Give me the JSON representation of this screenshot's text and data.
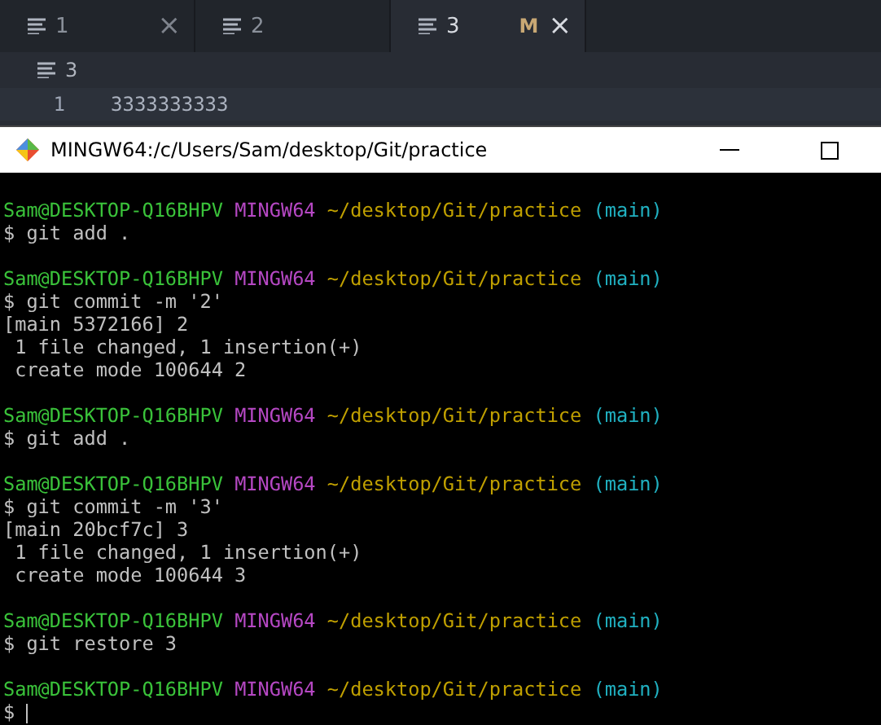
{
  "editor": {
    "tabs": [
      {
        "label": "1",
        "selected": false,
        "close": "×"
      },
      {
        "label": "2",
        "selected": false
      },
      {
        "label": "3",
        "selected": true,
        "modified": "M",
        "close": "×"
      }
    ],
    "breadcrumb": "3",
    "lines": [
      {
        "number": "1",
        "text": "3333333333"
      }
    ]
  },
  "terminal": {
    "title": "MINGW64:/c/Users/Sam/desktop/Git/practice",
    "lines": [
      {
        "kind": "blank"
      },
      {
        "kind": "prompt",
        "user": "Sam@DESKTOP-Q16BHPV",
        "system": "MINGW64",
        "path": "~/desktop/Git/practice",
        "branch": "(main)"
      },
      {
        "kind": "text",
        "text": "$ git add ."
      },
      {
        "kind": "blank"
      },
      {
        "kind": "prompt",
        "user": "Sam@DESKTOP-Q16BHPV",
        "system": "MINGW64",
        "path": "~/desktop/Git/practice",
        "branch": "(main)"
      },
      {
        "kind": "text",
        "text": "$ git commit -m '2'"
      },
      {
        "kind": "text",
        "text": "[main 5372166] 2"
      },
      {
        "kind": "text",
        "text": " 1 file changed, 1 insertion(+)"
      },
      {
        "kind": "text",
        "text": " create mode 100644 2"
      },
      {
        "kind": "blank"
      },
      {
        "kind": "prompt",
        "user": "Sam@DESKTOP-Q16BHPV",
        "system": "MINGW64",
        "path": "~/desktop/Git/practice",
        "branch": "(main)"
      },
      {
        "kind": "text",
        "text": "$ git add ."
      },
      {
        "kind": "blank"
      },
      {
        "kind": "prompt",
        "user": "Sam@DESKTOP-Q16BHPV",
        "system": "MINGW64",
        "path": "~/desktop/Git/practice",
        "branch": "(main)"
      },
      {
        "kind": "text",
        "text": "$ git commit -m '3'"
      },
      {
        "kind": "text",
        "text": "[main 20bcf7c] 3"
      },
      {
        "kind": "text",
        "text": " 1 file changed, 1 insertion(+)"
      },
      {
        "kind": "text",
        "text": " create mode 100644 3"
      },
      {
        "kind": "blank"
      },
      {
        "kind": "prompt",
        "user": "Sam@DESKTOP-Q16BHPV",
        "system": "MINGW64",
        "path": "~/desktop/Git/practice",
        "branch": "(main)"
      },
      {
        "kind": "text",
        "text": "$ git restore 3"
      },
      {
        "kind": "blank"
      },
      {
        "kind": "prompt",
        "user": "Sam@DESKTOP-Q16BHPV",
        "system": "MINGW64",
        "path": "~/desktop/Git/practice",
        "branch": "(main)"
      },
      {
        "kind": "input",
        "text": "$"
      }
    ]
  }
}
